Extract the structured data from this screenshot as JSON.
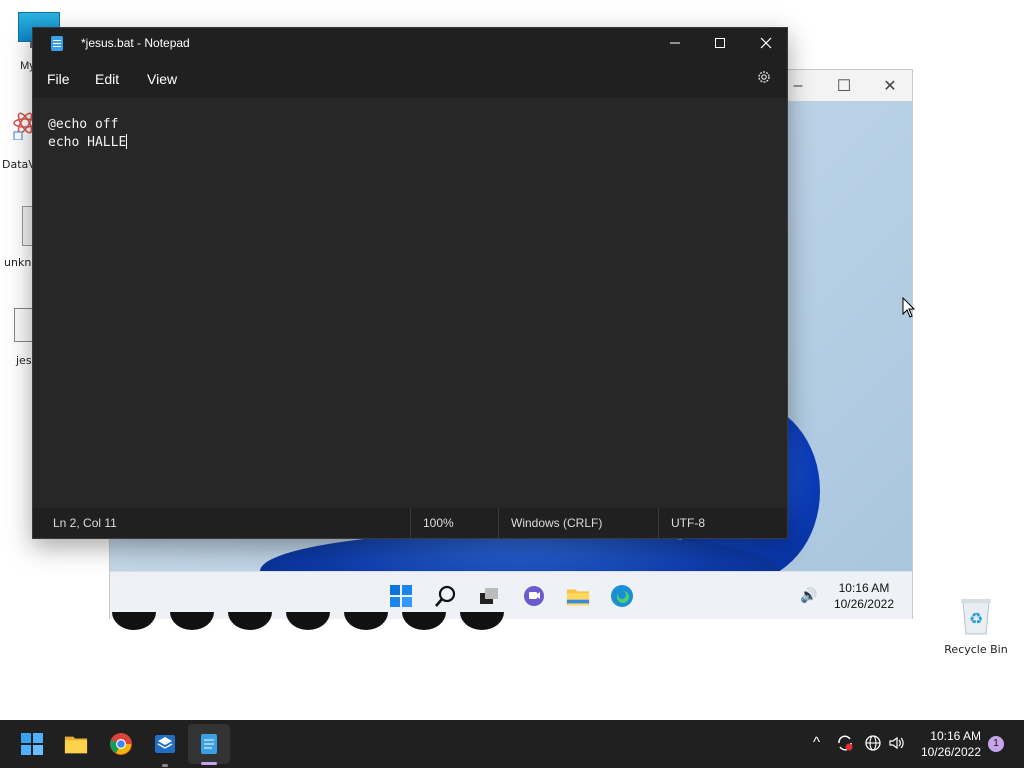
{
  "desktop": {
    "icons": [
      {
        "label": "My C"
      },
      {
        "label": "DataV"
      },
      {
        "label": "unkn"
      },
      {
        "label": "jes"
      }
    ],
    "recycle_bin": {
      "label": "Recycle Bin"
    }
  },
  "notepad": {
    "title": "*jesus.bat - Notepad",
    "menu": {
      "file": "File",
      "edit": "Edit",
      "view": "View"
    },
    "content": {
      "lines": [
        "@echo off",
        "echo HALLE"
      ]
    },
    "status": {
      "position": "Ln 2, Col 11",
      "zoom": "100%",
      "line_ending": "Windows (CRLF)",
      "encoding": "UTF-8"
    },
    "icons": {
      "minimize": "minimize-icon",
      "maximize": "maximize-icon",
      "close": "close-icon",
      "settings": "gear-icon"
    }
  },
  "vm_window": {
    "taskbar": {
      "time": "10:16 AM",
      "date": "10/26/2022"
    }
  },
  "taskbar": {
    "time": "10:16 AM",
    "date": "10/26/2022",
    "notification_count": "1",
    "accent": "#c7a3e9"
  }
}
